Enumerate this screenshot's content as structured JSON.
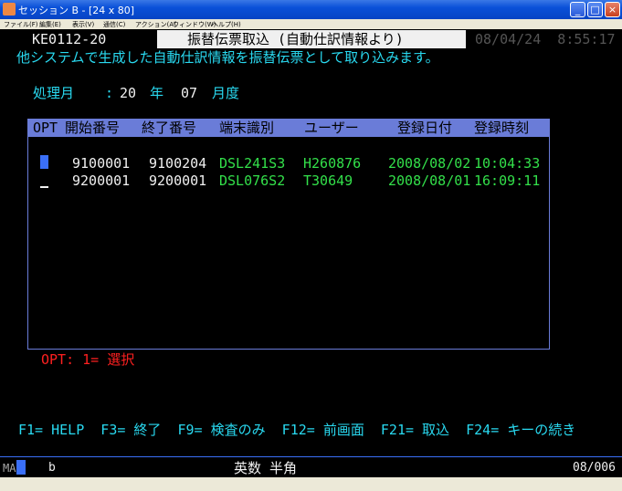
{
  "window": {
    "title": "セッション B - [24 x 80]",
    "min_label": "_",
    "max_label": "□",
    "close_label": "×"
  },
  "menu": [
    "ファイル(F)",
    "編集(E)",
    "表示(V)",
    "通信(C)",
    "アクション(A)",
    "ウィンドウ(W)",
    "ヘルプ(H)"
  ],
  "screen": {
    "screen_id": "KE0112-20",
    "title": "振替伝票取込 (自動仕訳情報より)",
    "timestamp": "08/04/24  8:55:17",
    "description": "他システムで生成した自動仕訳情報を振替伝票として取り込みます。",
    "period_label": "処理月",
    "period_colon": ":",
    "year_value": "20",
    "year_label": "年",
    "month_value": "07",
    "month_label": "月度",
    "table_headers": {
      "opt": "OPT",
      "start": "開始番号",
      "end": "終了番号",
      "terminal": "端末識別",
      "user": "ユーザー",
      "date": "登録日付",
      "time": "登録時刻"
    },
    "rows": [
      {
        "start": "9100001",
        "end": "9100204",
        "terminal": "DSL241S3",
        "user": "H260876",
        "date": "2008/08/02",
        "time": "10:04:33"
      },
      {
        "start": "9200001",
        "end": "9200001",
        "terminal": "DSL076S2",
        "user": "T30649",
        "date": "2008/08/01",
        "time": "16:09:11"
      }
    ],
    "opt_hint": "OPT: 1= 選択",
    "function_keys": "F1= HELP  F3= 終了  F9= 検査のみ  F12= 前画面  F21= 取込  F24= キーの続き"
  },
  "status": {
    "mode": "MA",
    "indicator": "b",
    "input_mode": "英数 半角",
    "cursor_pos": "08/006"
  }
}
